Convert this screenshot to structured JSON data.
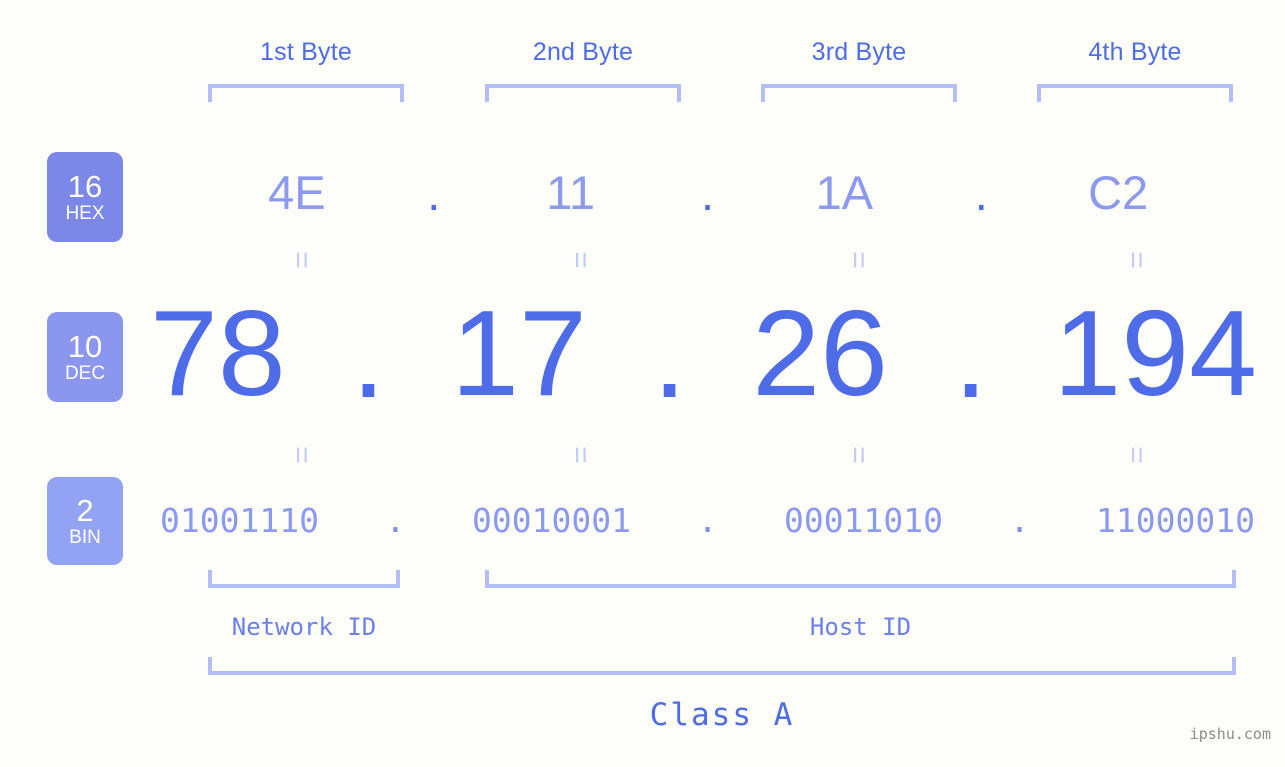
{
  "ip": {
    "hex": "4E.11.1A.C2",
    "dec": "78.17.26.194",
    "bin": "01001110.00010001.00011010.11000010"
  },
  "byte_headers": [
    {
      "label": "1st Byte"
    },
    {
      "label": "2nd Byte"
    },
    {
      "label": "3rd Byte"
    },
    {
      "label": "4th Byte"
    }
  ],
  "rows": {
    "hex": {
      "badge_num": "16",
      "badge_abbr": "HEX",
      "cells": [
        "4E",
        "11",
        "1A",
        "C2"
      ],
      "separator": "."
    },
    "dec": {
      "badge_num": "10",
      "badge_abbr": "DEC",
      "cells": [
        "78",
        "17",
        "26",
        "194"
      ],
      "separator": "."
    },
    "bin": {
      "badge_num": "2",
      "badge_abbr": "BIN",
      "cells": [
        "01001110",
        "00010001",
        "00011010",
        "11000010"
      ],
      "separator": "."
    }
  },
  "equals_symbol": "=",
  "sections": {
    "network_id": "Network ID",
    "host_id": "Host ID",
    "class": "Class A"
  },
  "watermark": "ipshu.com",
  "colors": {
    "background": "#fdfdfa",
    "accent_strong": "#4f6ce8",
    "accent_light": "#8b9aee",
    "bracket": "#b3bdf7",
    "badge_hex": "#7b88e8",
    "badge_dec": "#8b96ee",
    "badge_bin": "#93a3f3",
    "watermark": "#8c8c8c"
  }
}
